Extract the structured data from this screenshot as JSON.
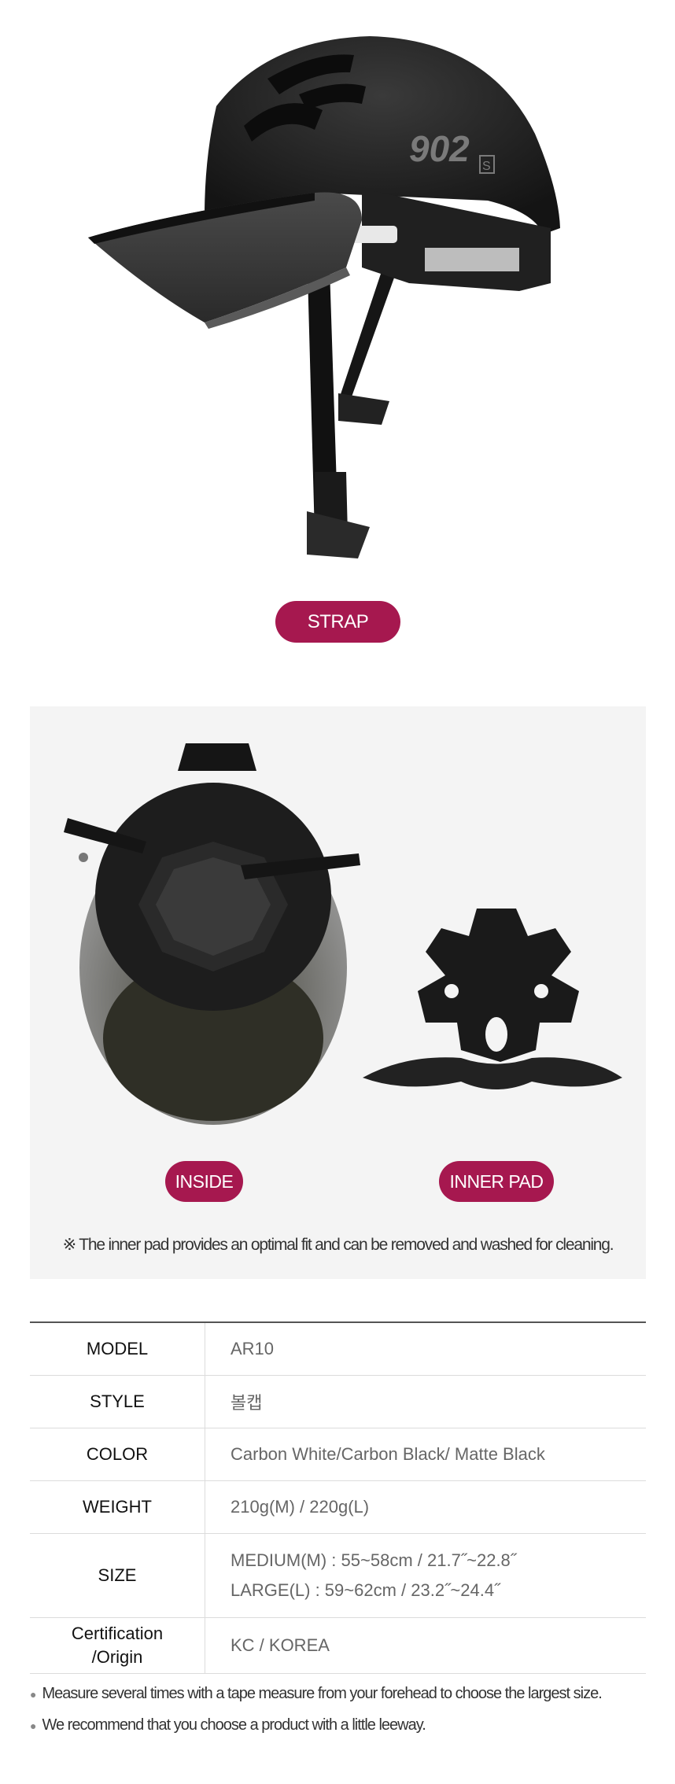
{
  "helmet_side": {
    "logo_text": "902",
    "size_mark": "S"
  },
  "strap_label": "STRAP",
  "inside_label": "INSIDE",
  "innerpad_label": "INNER PAD",
  "panel_note": "※ The inner pad provides an optimal fit and can be removed and washed for cleaning.",
  "specs": {
    "model": {
      "label": "MODEL",
      "value": "AR10"
    },
    "style": {
      "label": "STYLE",
      "value": "볼캡"
    },
    "color": {
      "label": "COLOR",
      "value": "Carbon White/Carbon Black/ Matte Black"
    },
    "weight": {
      "label": "WEIGHT",
      "value": "210g(M) / 220g(L)"
    },
    "size": {
      "label": "SIZE",
      "value_medium": "MEDIUM(M) : 55~58cm / 21.7˝~22.8˝",
      "value_large": "LARGE(L) : 59~62cm / 23.2˝~24.4˝"
    },
    "cert": {
      "label_line1": "Certification",
      "label_line2": "/Origin",
      "value": "KC / KOREA"
    }
  },
  "notes": [
    "Measure several times with a tape measure from your forehead to choose the largest size.",
    "We recommend that you choose a product with a little leeway."
  ],
  "colors": {
    "accent": "#a6184f",
    "panel": "#f4f4f4",
    "helmet": "#1c1c1c"
  }
}
